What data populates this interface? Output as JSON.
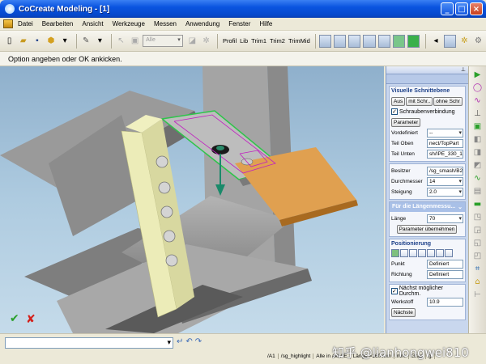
{
  "window": {
    "title": "CoCreate Modeling - [1]",
    "minimize": "_",
    "maximize": "□",
    "close": "×"
  },
  "menu": [
    "Datei",
    "Bearbeiten",
    "Ansicht",
    "Werkzeuge",
    "Messen",
    "Anwendung",
    "Fenster",
    "Hilfe"
  ],
  "toolbar": {
    "filter_combo": "Alle",
    "commands": [
      "Profil",
      "Lib",
      "Trim1",
      "Trim2",
      "TrimMid"
    ]
  },
  "prompt": "Option angeben oder OK ankicken.",
  "panel": {
    "section1": {
      "title": "Visuelle Schnittebene",
      "btn_aus": "Aus",
      "btn_mit": "mit Schr..",
      "btn_ohne": "ohne Schr",
      "checkbox": "Schraubenverbindung",
      "btn_param": "Parameter",
      "rows": [
        {
          "label": "Vordefiniert",
          "value": "--"
        },
        {
          "label": "Teil Oben",
          "value": "nect/TopPart"
        },
        {
          "label": "Teil Unten",
          "value": "sh/IPE_330_1"
        }
      ]
    },
    "section2": {
      "rows": [
        {
          "label": "Besitzer",
          "value": "/sg_smash/B2"
        },
        {
          "label": "Durchmesser",
          "value": "14"
        },
        {
          "label": "Steigung",
          "value": "2.0"
        }
      ]
    },
    "section3": {
      "title": "Für die Längenmessu...",
      "row": {
        "label": "Länge",
        "value": "70"
      },
      "btn": "Parameter übernehmen"
    },
    "section4": {
      "title": "Positionierung",
      "rows": [
        {
          "label": "Punkt",
          "value": "Definiert"
        },
        {
          "label": "Richtung",
          "value": "Definiert"
        }
      ]
    },
    "checkbox2": "Nächst möglicher Durchm.",
    "werkstoff": {
      "label": "Werkstoff",
      "value": "10.9"
    },
    "next_btn": "Nächste"
  },
  "status": {
    "cells": [
      "/A1",
      "/sg_highlight",
      "Alle in akt AE",
      "Länge =160 mm",
      "mm",
      "Grad",
      "g"
    ],
    "watermark": "知乎 @lianhongwei810"
  }
}
